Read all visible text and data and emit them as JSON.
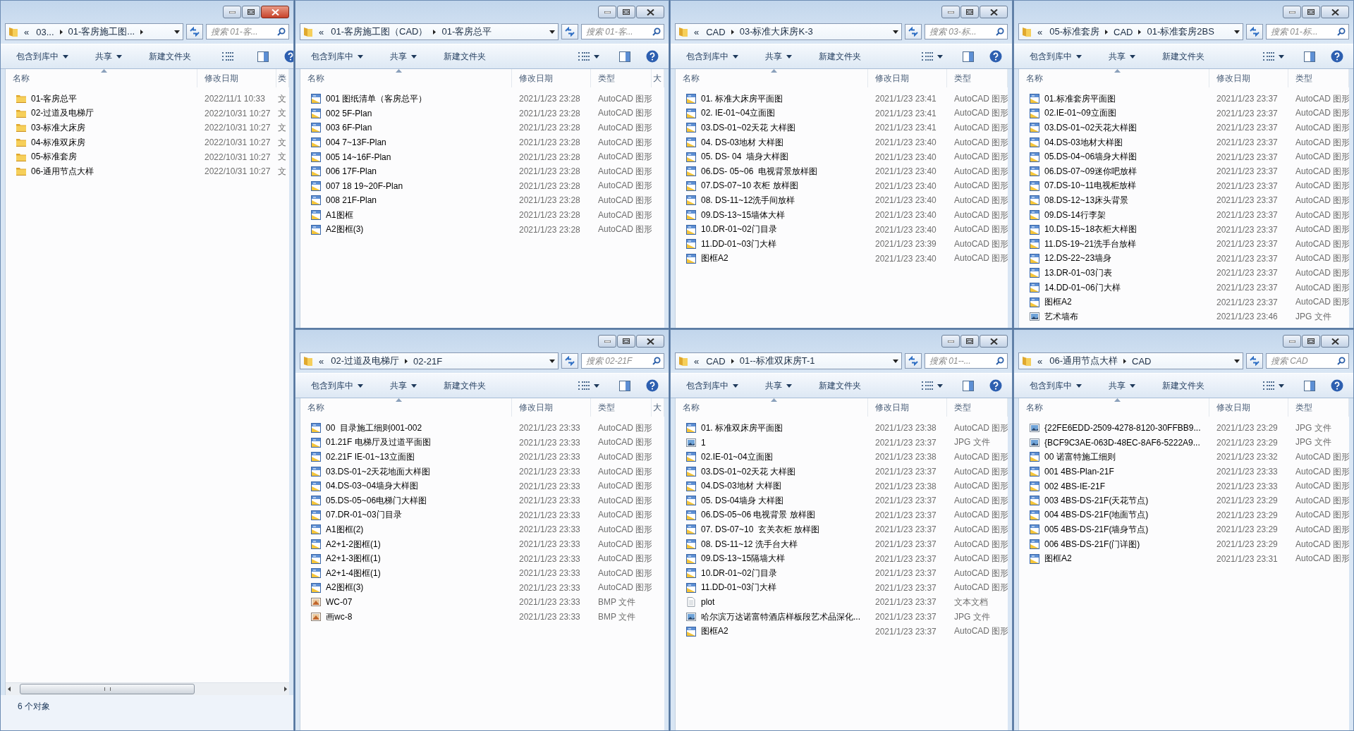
{
  "windows": [
    {
      "active": true,
      "overflow_mark": "«",
      "breadcrumbs": [
        "03...",
        "01-客房施工图..."
      ],
      "trailing_arrow": true,
      "search": {
        "placeholder": "搜索 01-客..."
      },
      "toolbar": [
        {
          "label": "包含到库中",
          "kind": "menu"
        },
        {
          "label": "共享",
          "kind": "menu"
        },
        {
          "label": "新建文件夹",
          "kind": "plain"
        }
      ],
      "columns": [
        {
          "label": "名称",
          "partial": false
        },
        {
          "label": "修改日期",
          "partial": false
        },
        {
          "label": "类",
          "partial": true
        }
      ],
      "rows": [
        {
          "kind": "folder",
          "name": "01-客房总平",
          "date": "2022/11/1 10:33",
          "type": "文"
        },
        {
          "kind": "folder",
          "name": "02-过道及电梯厅",
          "date": "2022/10/31 10:27",
          "type": "文"
        },
        {
          "kind": "folder",
          "name": "03-标准大床房",
          "date": "2022/10/31 10:27",
          "type": "文"
        },
        {
          "kind": "folder",
          "name": "04-标准双床房",
          "date": "2022/10/31 10:27",
          "type": "文"
        },
        {
          "kind": "folder",
          "name": "05-标准套房",
          "date": "2022/10/31 10:27",
          "type": "文"
        },
        {
          "kind": "folder",
          "name": "06-通用节点大样",
          "date": "2022/10/31 10:27",
          "type": "文"
        }
      ],
      "status_bar": "6 个对象"
    },
    {
      "active": false,
      "overflow_mark": "«",
      "breadcrumbs": [
        "01-客房施工图（CAD）",
        "01-客房总平"
      ],
      "trailing_arrow": false,
      "search": {
        "placeholder": "搜索 01-客..."
      },
      "toolbar": [
        {
          "label": "包含到库中",
          "kind": "menu"
        },
        {
          "label": "共享",
          "kind": "menu"
        },
        {
          "label": "新建文件夹",
          "kind": "plain"
        }
      ],
      "columns": [
        {
          "label": "名称",
          "partial": false
        },
        {
          "label": "修改日期",
          "partial": false
        },
        {
          "label": "类型",
          "partial": false
        },
        {
          "label": "大",
          "partial": true
        }
      ],
      "rows": [
        {
          "kind": "dwg",
          "name": "001 图纸清单（客房总平）",
          "date": "2021/1/23 23:28",
          "type": "AutoCAD 图形"
        },
        {
          "kind": "dwg",
          "name": "002 5F-Plan",
          "date": "2021/1/23 23:28",
          "type": "AutoCAD 图形"
        },
        {
          "kind": "dwg",
          "name": "003 6F-Plan",
          "date": "2021/1/23 23:28",
          "type": "AutoCAD 图形"
        },
        {
          "kind": "dwg",
          "name": "004 7~13F-Plan",
          "date": "2021/1/23 23:28",
          "type": "AutoCAD 图形"
        },
        {
          "kind": "dwg",
          "name": "005 14~16F-Plan",
          "date": "2021/1/23 23:28",
          "type": "AutoCAD 图形"
        },
        {
          "kind": "dwg",
          "name": "006 17F-Plan",
          "date": "2021/1/23 23:28",
          "type": "AutoCAD 图形"
        },
        {
          "kind": "dwg",
          "name": "007 18 19~20F-Plan",
          "date": "2021/1/23 23:28",
          "type": "AutoCAD 图形"
        },
        {
          "kind": "dwg",
          "name": "008 21F-Plan",
          "date": "2021/1/23 23:28",
          "type": "AutoCAD 图形"
        },
        {
          "kind": "dwg",
          "name": "A1图框",
          "date": "2021/1/23 23:28",
          "type": "AutoCAD 图形"
        },
        {
          "kind": "dwg",
          "name": "A2图框(3)",
          "date": "2021/1/23 23:28",
          "type": "AutoCAD 图形"
        }
      ]
    },
    {
      "active": false,
      "overflow_mark": "«",
      "breadcrumbs": [
        "CAD",
        "03-标准大床房K-3"
      ],
      "trailing_arrow": false,
      "search": {
        "placeholder": "搜索 03-标..."
      },
      "toolbar": [
        {
          "label": "包含到库中",
          "kind": "menu"
        },
        {
          "label": "共享",
          "kind": "menu"
        },
        {
          "label": "新建文件夹",
          "kind": "plain"
        }
      ],
      "columns": [
        {
          "label": "名称",
          "partial": false
        },
        {
          "label": "修改日期",
          "partial": false
        },
        {
          "label": "类型",
          "partial": false
        }
      ],
      "rows": [
        {
          "kind": "dwg",
          "name": "01. 标准大床房平面图",
          "date": "2021/1/23 23:41",
          "type": "AutoCAD 图形"
        },
        {
          "kind": "dwg",
          "name": "02. IE-01~04立面图",
          "date": "2021/1/23 23:41",
          "type": "AutoCAD 图形"
        },
        {
          "kind": "dwg",
          "name": "03.DS-01~02天花 大样图",
          "date": "2021/1/23 23:41",
          "type": "AutoCAD 图形"
        },
        {
          "kind": "dwg",
          "name": "04. DS-03地材 大样图",
          "date": "2021/1/23 23:40",
          "type": "AutoCAD 图形"
        },
        {
          "kind": "dwg",
          "name": "05. DS- 04  墙身大样图",
          "date": "2021/1/23 23:40",
          "type": "AutoCAD 图形"
        },
        {
          "kind": "dwg",
          "name": "06.DS- 05~06  电视背景放样图",
          "date": "2021/1/23 23:40",
          "type": "AutoCAD 图形"
        },
        {
          "kind": "dwg",
          "name": "07.DS-07~10 衣柜 放样图",
          "date": "2021/1/23 23:40",
          "type": "AutoCAD 图形"
        },
        {
          "kind": "dwg",
          "name": "08. DS-11~12洗手间放样",
          "date": "2021/1/23 23:40",
          "type": "AutoCAD 图形"
        },
        {
          "kind": "dwg",
          "name": "09.DS-13~15墙体大样",
          "date": "2021/1/23 23:40",
          "type": "AutoCAD 图形"
        },
        {
          "kind": "dwg",
          "name": "10.DR-01~02门目录",
          "date": "2021/1/23 23:40",
          "type": "AutoCAD 图形"
        },
        {
          "kind": "dwg",
          "name": "11.DD-01~03门大样",
          "date": "2021/1/23 23:39",
          "type": "AutoCAD 图形"
        },
        {
          "kind": "dwg",
          "name": "图框A2",
          "date": "2021/1/23 23:40",
          "type": "AutoCAD 图形"
        }
      ]
    },
    {
      "active": false,
      "overflow_mark": "«",
      "breadcrumbs": [
        "05-标准套房",
        "CAD",
        "01-标准套房2BS"
      ],
      "trailing_arrow": false,
      "search": {
        "placeholder": "搜索 01-标..."
      },
      "toolbar": [
        {
          "label": "包含到库中",
          "kind": "menu"
        },
        {
          "label": "共享",
          "kind": "menu"
        },
        {
          "label": "新建文件夹",
          "kind": "plain"
        }
      ],
      "columns": [
        {
          "label": "名称",
          "partial": false
        },
        {
          "label": "修改日期",
          "partial": false
        },
        {
          "label": "类型",
          "partial": false
        }
      ],
      "rows": [
        {
          "kind": "dwg",
          "name": "01.标准套房平面图",
          "date": "2021/1/23 23:37",
          "type": "AutoCAD 图形"
        },
        {
          "kind": "dwg",
          "name": "02.IE-01~09立面图",
          "date": "2021/1/23 23:37",
          "type": "AutoCAD 图形"
        },
        {
          "kind": "dwg",
          "name": "03.DS-01~02天花大样图",
          "date": "2021/1/23 23:37",
          "type": "AutoCAD 图形"
        },
        {
          "kind": "dwg",
          "name": "04.DS-03地材大样图",
          "date": "2021/1/23 23:37",
          "type": "AutoCAD 图形"
        },
        {
          "kind": "dwg",
          "name": "05.DS-04~06墙身大样图",
          "date": "2021/1/23 23:37",
          "type": "AutoCAD 图形"
        },
        {
          "kind": "dwg",
          "name": "06.DS-07~09迷你吧放样",
          "date": "2021/1/23 23:37",
          "type": "AutoCAD 图形"
        },
        {
          "kind": "dwg",
          "name": "07.DS-10~11电视柜放样",
          "date": "2021/1/23 23:37",
          "type": "AutoCAD 图形"
        },
        {
          "kind": "dwg",
          "name": "08.DS-12~13床头背景",
          "date": "2021/1/23 23:37",
          "type": "AutoCAD 图形"
        },
        {
          "kind": "dwg",
          "name": "09.DS-14行李架",
          "date": "2021/1/23 23:37",
          "type": "AutoCAD 图形"
        },
        {
          "kind": "dwg",
          "name": "10.DS-15~18衣柜大样图",
          "date": "2021/1/23 23:37",
          "type": "AutoCAD 图形"
        },
        {
          "kind": "dwg",
          "name": "11.DS-19~21洗手台放样",
          "date": "2021/1/23 23:37",
          "type": "AutoCAD 图形"
        },
        {
          "kind": "dwg",
          "name": "12.DS-22~23墙身",
          "date": "2021/1/23 23:37",
          "type": "AutoCAD 图形"
        },
        {
          "kind": "dwg",
          "name": "13.DR-01~03门表",
          "date": "2021/1/23 23:37",
          "type": "AutoCAD 图形"
        },
        {
          "kind": "dwg",
          "name": "14.DD-01~06门大样",
          "date": "2021/1/23 23:37",
          "type": "AutoCAD 图形"
        },
        {
          "kind": "dwg",
          "name": "图框A2",
          "date": "2021/1/23 23:37",
          "type": "AutoCAD 图形"
        },
        {
          "kind": "jpg",
          "name": "艺术墙布",
          "date": "2021/1/23 23:46",
          "type": "JPG 文件"
        }
      ]
    },
    {
      "active": false,
      "overflow_mark": "«",
      "breadcrumbs": [
        "02-过道及电梯厅",
        "02-21F"
      ],
      "trailing_arrow": false,
      "search": {
        "placeholder": "搜索 02-21F"
      },
      "toolbar": [
        {
          "label": "包含到库中",
          "kind": "menu"
        },
        {
          "label": "共享",
          "kind": "menu"
        },
        {
          "label": "新建文件夹",
          "kind": "plain"
        }
      ],
      "columns": [
        {
          "label": "名称",
          "partial": false
        },
        {
          "label": "修改日期",
          "partial": false
        },
        {
          "label": "类型",
          "partial": false
        },
        {
          "label": "大",
          "partial": true
        }
      ],
      "rows": [
        {
          "kind": "dwg",
          "name": "00  目录施工细则001-002",
          "date": "2021/1/23 23:33",
          "type": "AutoCAD 图形"
        },
        {
          "kind": "dwg",
          "name": "01.21F 电梯厅及过道平面图",
          "date": "2021/1/23 23:33",
          "type": "AutoCAD 图形"
        },
        {
          "kind": "dwg",
          "name": "02.21F IE-01~13立面图",
          "date": "2021/1/23 23:33",
          "type": "AutoCAD 图形"
        },
        {
          "kind": "dwg",
          "name": "03.DS-01~2天花地面大样图",
          "date": "2021/1/23 23:33",
          "type": "AutoCAD 图形"
        },
        {
          "kind": "dwg",
          "name": "04.DS-03~04墙身大样图",
          "date": "2021/1/23 23:33",
          "type": "AutoCAD 图形"
        },
        {
          "kind": "dwg",
          "name": "05.DS-05~06电梯门大样图",
          "date": "2021/1/23 23:33",
          "type": "AutoCAD 图形"
        },
        {
          "kind": "dwg",
          "name": "07.DR-01~03门目录",
          "date": "2021/1/23 23:33",
          "type": "AutoCAD 图形"
        },
        {
          "kind": "dwg",
          "name": "A1图框(2)",
          "date": "2021/1/23 23:33",
          "type": "AutoCAD 图形"
        },
        {
          "kind": "dwg",
          "name": "A2+1-2图框(1)",
          "date": "2021/1/23 23:33",
          "type": "AutoCAD 图形"
        },
        {
          "kind": "dwg",
          "name": "A2+1-3图框(1)",
          "date": "2021/1/23 23:33",
          "type": "AutoCAD 图形"
        },
        {
          "kind": "dwg",
          "name": "A2+1-4图框(1)",
          "date": "2021/1/23 23:33",
          "type": "AutoCAD 图形"
        },
        {
          "kind": "dwg",
          "name": "A2图框(3)",
          "date": "2021/1/23 23:33",
          "type": "AutoCAD 图形"
        },
        {
          "kind": "bmp",
          "name": "WC-07",
          "date": "2021/1/23 23:33",
          "type": "BMP 文件"
        },
        {
          "kind": "bmp",
          "name": "画wc-8",
          "date": "2021/1/23 23:33",
          "type": "BMP 文件"
        }
      ]
    },
    {
      "active": false,
      "overflow_mark": "«",
      "breadcrumbs": [
        "CAD",
        "01--标准双床房T-1"
      ],
      "trailing_arrow": false,
      "search": {
        "placeholder": "搜索 01--..."
      },
      "toolbar": [
        {
          "label": "包含到库中",
          "kind": "menu"
        },
        {
          "label": "共享",
          "kind": "menu"
        },
        {
          "label": "新建文件夹",
          "kind": "plain"
        }
      ],
      "columns": [
        {
          "label": "名称",
          "partial": false
        },
        {
          "label": "修改日期",
          "partial": false
        },
        {
          "label": "类型",
          "partial": false
        }
      ],
      "rows": [
        {
          "kind": "dwg",
          "name": "01. 标准双床房平面图",
          "date": "2021/1/23 23:38",
          "type": "AutoCAD 图形"
        },
        {
          "kind": "jpg",
          "name": "1",
          "date": "2021/1/23 23:37",
          "type": "JPG 文件"
        },
        {
          "kind": "dwg",
          "name": "02.IE-01~04立面图",
          "date": "2021/1/23 23:38",
          "type": "AutoCAD 图形"
        },
        {
          "kind": "dwg",
          "name": "03.DS-01~02天花 大样图",
          "date": "2021/1/23 23:37",
          "type": "AutoCAD 图形"
        },
        {
          "kind": "dwg",
          "name": "04.DS-03地材 大样图",
          "date": "2021/1/23 23:38",
          "type": "AutoCAD 图形"
        },
        {
          "kind": "dwg",
          "name": "05. DS-04墙身 大样图",
          "date": "2021/1/23 23:37",
          "type": "AutoCAD 图形"
        },
        {
          "kind": "dwg",
          "name": "06.DS-05~06 电视背景 放样图",
          "date": "2021/1/23 23:37",
          "type": "AutoCAD 图形"
        },
        {
          "kind": "dwg",
          "name": "07. DS-07~10  玄关衣柜 放样图",
          "date": "2021/1/23 23:37",
          "type": "AutoCAD 图形"
        },
        {
          "kind": "dwg",
          "name": "08. DS-11~12 洗手台大样",
          "date": "2021/1/23 23:37",
          "type": "AutoCAD 图形"
        },
        {
          "kind": "dwg",
          "name": "09.DS-13~15隔墙大样",
          "date": "2021/1/23 23:37",
          "type": "AutoCAD 图形"
        },
        {
          "kind": "dwg",
          "name": "10.DR-01~02门目录",
          "date": "2021/1/23 23:37",
          "type": "AutoCAD 图形"
        },
        {
          "kind": "dwg",
          "name": "11.DD-01~03门大样",
          "date": "2021/1/23 23:37",
          "type": "AutoCAD 图形"
        },
        {
          "kind": "txt",
          "name": "plot",
          "date": "2021/1/23 23:37",
          "type": "文本文档"
        },
        {
          "kind": "jpg",
          "name": "哈尔滨万达诺富特酒店样板段艺术品深化...",
          "date": "2021/1/23 23:37",
          "type": "JPG 文件"
        },
        {
          "kind": "dwg",
          "name": "图框A2",
          "date": "2021/1/23 23:37",
          "type": "AutoCAD 图形"
        }
      ]
    },
    {
      "active": false,
      "overflow_mark": "«",
      "breadcrumbs": [
        "06-通用节点大样",
        "CAD"
      ],
      "trailing_arrow": false,
      "search": {
        "placeholder": "搜索 CAD"
      },
      "toolbar": [
        {
          "label": "包含到库中",
          "kind": "menu"
        },
        {
          "label": "共享",
          "kind": "menu"
        },
        {
          "label": "新建文件夹",
          "kind": "plain"
        }
      ],
      "columns": [
        {
          "label": "名称",
          "partial": false
        },
        {
          "label": "修改日期",
          "partial": false
        },
        {
          "label": "类型",
          "partial": false
        }
      ],
      "rows": [
        {
          "kind": "jpg",
          "name": "{22FE6EDD-2509-4278-8120-30FFBB9...",
          "date": "2021/1/23 23:29",
          "type": "JPG 文件"
        },
        {
          "kind": "jpg",
          "name": "{BCF9C3AE-063D-48EC-8AF6-5222A9...",
          "date": "2021/1/23 23:29",
          "type": "JPG 文件"
        },
        {
          "kind": "dwg",
          "name": "00 诺富特施工细则",
          "date": "2021/1/23 23:32",
          "type": "AutoCAD 图形"
        },
        {
          "kind": "dwg",
          "name": "001 4BS-Plan-21F",
          "date": "2021/1/23 23:33",
          "type": "AutoCAD 图形"
        },
        {
          "kind": "dwg",
          "name": "002 4BS-IE-21F",
          "date": "2021/1/23 23:33",
          "type": "AutoCAD 图形"
        },
        {
          "kind": "dwg",
          "name": "003 4BS-DS-21F(天花节点)",
          "date": "2021/1/23 23:29",
          "type": "AutoCAD 图形"
        },
        {
          "kind": "dwg",
          "name": "004 4BS-DS-21F(地面节点)",
          "date": "2021/1/23 23:29",
          "type": "AutoCAD 图形"
        },
        {
          "kind": "dwg",
          "name": "005 4BS-DS-21F(墙身节点)",
          "date": "2021/1/23 23:29",
          "type": "AutoCAD 图形"
        },
        {
          "kind": "dwg",
          "name": "006 4BS-DS-21F(门详图)",
          "date": "2021/1/23 23:29",
          "type": "AutoCAD 图形"
        },
        {
          "kind": "dwg",
          "name": "图框A2",
          "date": "2021/1/23 23:31",
          "type": "AutoCAD 图形"
        }
      ]
    }
  ]
}
